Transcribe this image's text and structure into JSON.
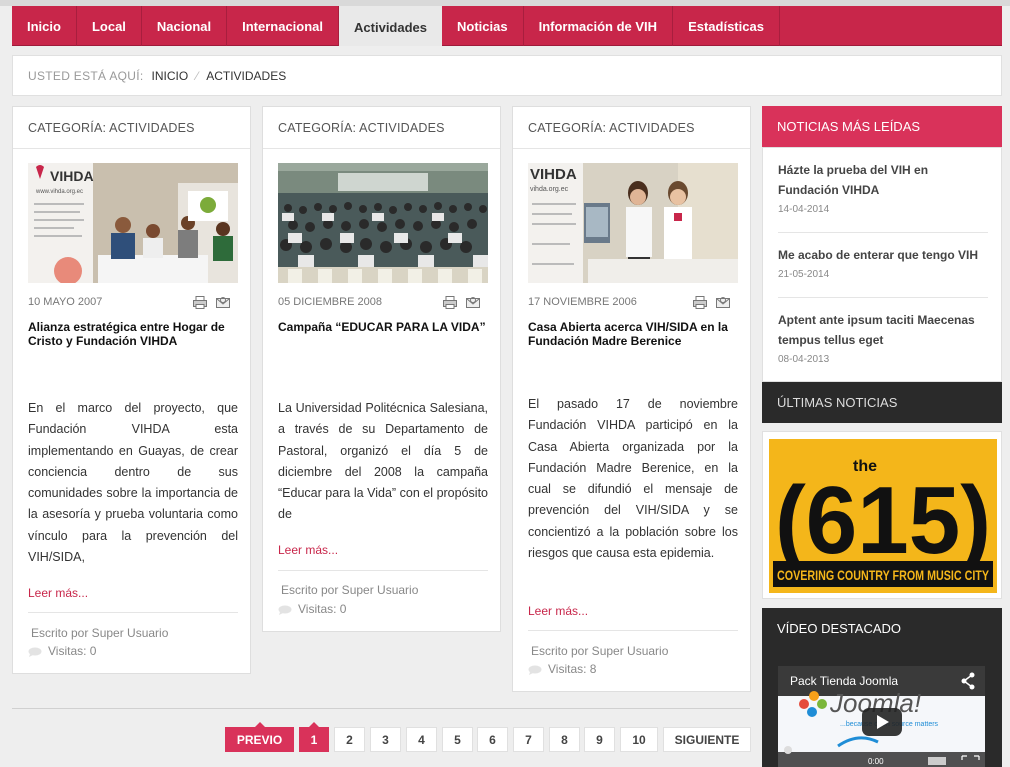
{
  "nav": {
    "items": [
      {
        "label": "Inicio"
      },
      {
        "label": "Local"
      },
      {
        "label": "Nacional"
      },
      {
        "label": "Internacional"
      },
      {
        "label": "Actividades",
        "active": true
      },
      {
        "label": "Noticias"
      },
      {
        "label": "Información de VIH"
      },
      {
        "label": "Estadísticas"
      }
    ]
  },
  "breadcrumb": {
    "label": "Usted está aquí:",
    "home": "Inicio",
    "current": "Actividades"
  },
  "articles": [
    {
      "category": "Categoría: Actividades",
      "date": "10 Mayo 2007",
      "title": "Alianza estratégica entre Hogar de Cristo y Fundación VIHDA",
      "body": "En el marco del proyecto, que Fundación VIHDA esta implementando en Guayas, de crear conciencia dentro de sus comunidades sobre la importancia de la asesoría y prueba voluntaria como vínculo para la prevención del VIH/SIDA,",
      "readmore": "Leer más...",
      "author": "Escrito por Super Usuario",
      "visits": "Visitas: 0",
      "img_logo": "VIHDA",
      "img_url": "www.vihda.org.ec"
    },
    {
      "category": "Categoría: Actividades",
      "date": "05 Diciembre 2008",
      "title": "Campaña “EDUCAR PARA LA VIDA”",
      "body": "La Universidad Politécnica Salesiana, a través de su Departamento de Pastoral, organizó el día 5 de diciembre del 2008 la campaña “Educar para la Vida” con el propósito de",
      "readmore": "Leer más...",
      "author": "Escrito por Super Usuario",
      "visits": "Visitas: 0"
    },
    {
      "category": "Categoría: Actividades",
      "date": "17 Noviembre 2006",
      "title": "Casa Abierta acerca VIH/SIDA en la Fundación Madre Berenice",
      "body": "El pasado 17 de noviembre Fundación VIHDA participó en la Casa Abierta organizada por la Fundación Madre Berenice, en la cual se difundió el mensaje de prevención del VIH/SIDA y se concientizó a la población sobre los riesgos que causa esta epidemia.",
      "readmore": "Leer más...",
      "author": "Escrito por Super Usuario",
      "visits": "Visitas: 8",
      "img_logo": "VIHDA",
      "img_url": "vihda.org.ec"
    }
  ],
  "sidebar": {
    "popular_title": "Noticias más leídas",
    "popular": [
      {
        "title": "Házte la prueba del VIH en Fundación VIHDA",
        "date": "14-04-2014"
      },
      {
        "title": "Me acabo de enterar que tengo VIH",
        "date": "21-05-2014"
      },
      {
        "title": "Aptent ante ipsum taciti Maecenas tempus tellus eget",
        "date": "08-04-2013"
      }
    ],
    "latest_title": "Últimas noticias",
    "banner": {
      "the": "the",
      "number": "(615)",
      "tagline": "COVERING COUNTRY FROM MUSIC CITY"
    },
    "video_title": "Vídeo destacado",
    "video": {
      "caption": "Pack Tienda Joomla",
      "brand": "Joomla!",
      "slogan": "...because open source matters",
      "time": "0:00"
    }
  },
  "pagination": {
    "prev": "PREVIO",
    "pages": [
      "1",
      "2",
      "3",
      "4",
      "5",
      "6",
      "7",
      "8",
      "9",
      "10"
    ],
    "current": "1",
    "next": "SIGUIENTE"
  },
  "colors": {
    "accent": "#c8264a",
    "accent_light": "#d9325a",
    "dark": "#2a2a2a",
    "banner_yellow": "#f4b61a"
  }
}
